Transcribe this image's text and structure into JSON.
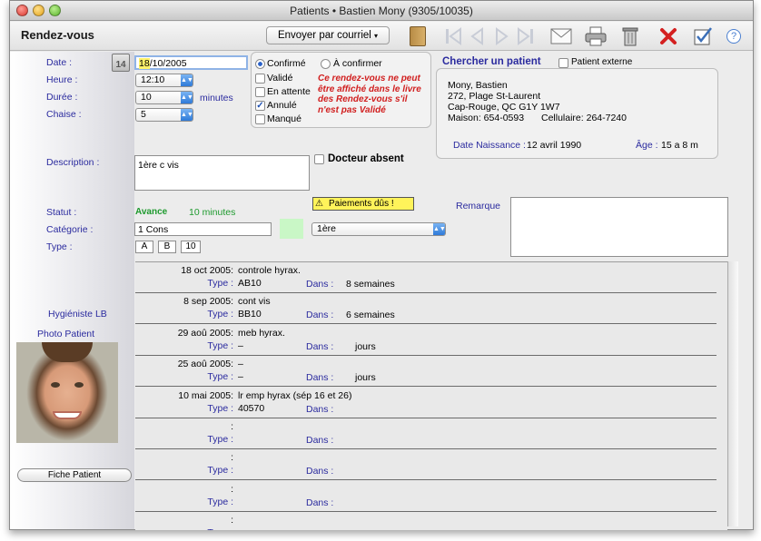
{
  "window": {
    "title": "Patients • Bastien Mony (9305/10035)"
  },
  "toolbar": {
    "section_title": "Rendez-vous",
    "email_button": "Envoyer par courriel",
    "email_arrow": "▾"
  },
  "form": {
    "date_label": "Date :",
    "date_value_highlight": "18",
    "date_value_rest": "/10/2005",
    "calendar_day": "14",
    "heure_label": "Heure :",
    "heure_value": "12:10",
    "duree_label": "Durée :",
    "duree_value": "10",
    "duree_unit": "minutes",
    "chaise_label": "Chaise :",
    "chaise_value": "5",
    "status_options": {
      "confirme": "Confirmé",
      "a_confirmer": "À confirmer",
      "valide": "Validé",
      "en_attente": "En attente",
      "annule": "Annulé",
      "manque": "Manqué"
    },
    "warning_text": "Ce rendez-vous ne peut être affiché dans le livre des Rendez-vous s'il n'est pas Validé",
    "description_label": "Description :",
    "description_value": "1ère c vis",
    "docteur_absent": "Docteur absent",
    "statut_label": "Statut :",
    "statut_value": "Avance",
    "statut_minutes": "10 minutes",
    "paiements_label": "Paiements dûs !",
    "remarque_label": "Remarque",
    "categorie_label": "Catégorie :",
    "categorie_value": "1 Cons",
    "categorie_popup": "1ère",
    "type_label": "Type :",
    "type_segments": [
      "A",
      "B",
      "10"
    ]
  },
  "patient": {
    "search_title": "Chercher un patient",
    "externe_label": "Patient externe",
    "name": "Mony, Bastien",
    "address1": "272, Plage St-Laurent",
    "address2": "Cap-Rouge, QC  G1Y 1W7",
    "maison": "Maison: 654-0593",
    "cellulaire": "Cellulaire: 264-7240",
    "naissance_label": "Date Naissance :",
    "naissance_value": "12 avril 1990",
    "age_label": "Âge :",
    "age_value": "15 a 8 m"
  },
  "sidebar": {
    "hygieniste": "Hygiéniste LB",
    "photo_label": "Photo Patient",
    "fiche_button": "Fiche Patient"
  },
  "history": [
    {
      "date": "18 oct 2005:",
      "note": "controle hyrax.",
      "type": "AB10",
      "dans": "8 semaines"
    },
    {
      "date": "8 sep 2005:",
      "note": "cont vis",
      "type": "BB10",
      "dans": "6 semaines"
    },
    {
      "date": "29 aoû 2005:",
      "note": "meb hyrax.",
      "type": "–",
      "dans": "jours"
    },
    {
      "date": "25 aoû 2005:",
      "note": "–",
      "type": "–",
      "dans": "jours"
    },
    {
      "date": "10 mai 2005:",
      "note": "lr emp hyrax (sép 16 et 26)",
      "type": "40570",
      "dans": ""
    },
    {
      "date": ":",
      "note": "",
      "type": "",
      "dans": ""
    },
    {
      "date": ":",
      "note": "",
      "type": "",
      "dans": ""
    },
    {
      "date": ":",
      "note": "",
      "type": "",
      "dans": ""
    },
    {
      "date": ":",
      "note": "",
      "type": "",
      "dans": ""
    }
  ],
  "history_labels": {
    "type": "Type :",
    "dans": "Dans :"
  }
}
